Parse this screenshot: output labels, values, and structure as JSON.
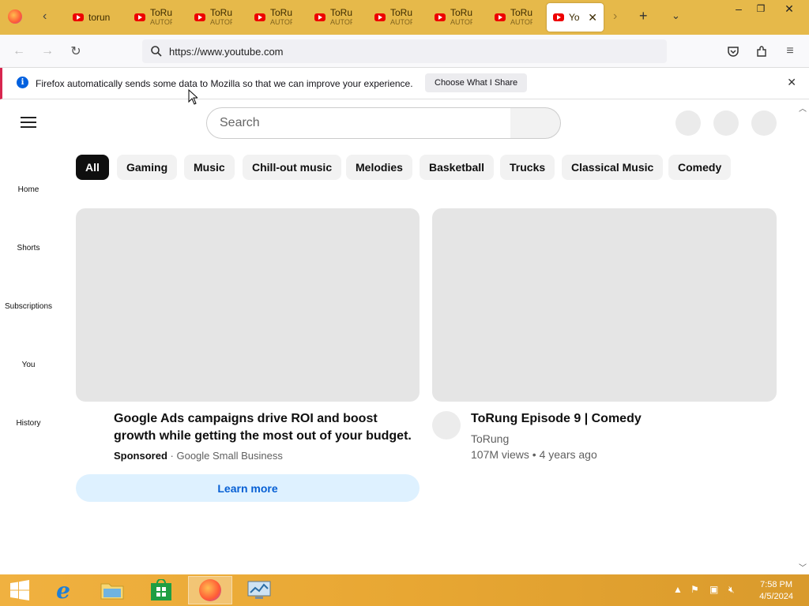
{
  "tabs": [
    {
      "title": "torun",
      "subtitle": ""
    },
    {
      "title": "ToRun",
      "subtitle": "AUTOP"
    },
    {
      "title": "ToRun",
      "subtitle": "AUTOP"
    },
    {
      "title": "ToRun",
      "subtitle": "AUTOP"
    },
    {
      "title": "ToRun",
      "subtitle": "AUTOP"
    },
    {
      "title": "ToRun",
      "subtitle": "AUTOP"
    },
    {
      "title": "ToRun",
      "subtitle": "AUTOP"
    },
    {
      "title": "ToRun",
      "subtitle": "AUTOP"
    },
    {
      "title": "Yo",
      "subtitle": ""
    }
  ],
  "url": "https://www.youtube.com",
  "notification": {
    "message": "Firefox automatically sends some data to Mozilla so that we can improve your experience.",
    "button": "Choose What I Share"
  },
  "search": {
    "placeholder": "Search"
  },
  "chips": [
    "All",
    "Gaming",
    "Music",
    "Chill-out music",
    "Melodies",
    "Basketball",
    "Trucks",
    "Classical Music",
    "Comedy"
  ],
  "sidebar": [
    "Home",
    "Shorts",
    "Subscriptions",
    "You",
    "History"
  ],
  "ad": {
    "title": "Google Ads campaigns drive ROI and boost growth while getting the most out of your budget.",
    "sponsored": "Sponsored",
    "advertiser": "Google Small Business",
    "cta": "Learn more"
  },
  "video": {
    "title": "ToRung Episode 9 | Comedy",
    "channel": "ToRung",
    "stats": "107M views • 4 years ago"
  },
  "clock": {
    "time": "7:58 PM",
    "date": "4/5/2024"
  },
  "colors": {
    "tabstrip": "#e6b94a",
    "accent": "#065fd4",
    "notif_bar": "#d7264f"
  }
}
